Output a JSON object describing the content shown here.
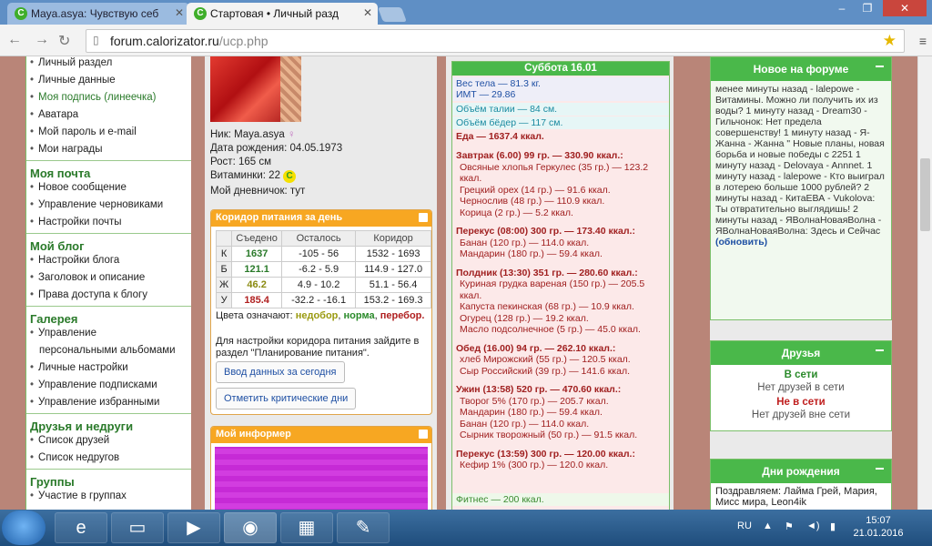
{
  "browser": {
    "tabs": [
      {
        "favicon": "C",
        "title": "Maya.asya: Чувствую себ"
      },
      {
        "favicon": "C",
        "title": "Стартовая • Личный разд"
      }
    ],
    "url_host": "forum.calorizator.ru",
    "url_path": "/ucp.php"
  },
  "sidebar": {
    "items_top": [
      "Личный раздел",
      "Личные данные",
      "Моя подпись (линеечка)",
      "Аватара",
      "Мой пароль и e-mail",
      "Мои награды"
    ],
    "sections": [
      {
        "title": "Моя почта",
        "items": [
          "Новое сообщение",
          "Управление черновиками",
          "Настройки почты"
        ]
      },
      {
        "title": "Мой блог",
        "items": [
          "Настройки блога",
          "Заголовок и описание",
          "Права доступа к блогу"
        ]
      },
      {
        "title": "Галерея",
        "items": [
          "Управление",
          "персональными альбомами",
          "Личные настройки",
          "Управление подписками",
          "Управление избранными"
        ]
      },
      {
        "title": "Друзья и недруги",
        "items": [
          "Список друзей",
          "Список недругов"
        ]
      },
      {
        "title": "Группы",
        "items": [
          "Участие в группах"
        ]
      }
    ]
  },
  "profile": {
    "nick_label": "Ник:",
    "nick": "Maya.asya",
    "birth_label": "Дата рождения:",
    "birth": "04.05.1973",
    "height_label": "Рост:",
    "height": "165 см",
    "vitamins_label": "Витаминки:",
    "vitamins": "22",
    "diary_label": "Мой дневничок:",
    "diary": "тут"
  },
  "corridor": {
    "title": "Коридор питания за день",
    "headers": [
      "Съедено",
      "Осталось",
      "Коридор"
    ],
    "rows": [
      {
        "l": "К",
        "eaten": "1637",
        "left1": "-105",
        "left2": "56",
        "c1": "1532",
        "c2": "1693"
      },
      {
        "l": "Б",
        "eaten": "121.1",
        "left1": "-6.2",
        "left2": "5.9",
        "c1": "114.9",
        "c2": "127.0"
      },
      {
        "l": "Ж",
        "eaten": "46.2",
        "left1": "4.9",
        "left2": "10.2",
        "c1": "51.1",
        "c2": "56.4"
      },
      {
        "l": "У",
        "eaten": "185.4",
        "left1": "-32.2",
        "left2": "-16.1",
        "c1": "153.2",
        "c2": "169.3"
      }
    ],
    "colors_text": "Цвета означают:",
    "c_under": "недобор",
    "c_norm": "норма",
    "c_over": "перебор.",
    "note": "Для настройки коридора питания зайдите в раздел \"Планирование питания\".",
    "btn_today": "Ввод данных за сегодня",
    "btn_crit": "Отметить критические дни"
  },
  "informer": {
    "title": "Мой информер"
  },
  "diary": {
    "date": "Суббота 16.01",
    "weight": "Вес тела — 81.3 кг.",
    "bmi": "ИМТ — 29.86",
    "waist": "Объём талии — 84 см.",
    "hips": "Объём бёдер — 117 см.",
    "food_total": "Еда — 1637.4 ккал.",
    "lines": [
      {
        "t": "Завтрак (6.00) 99 гр. — 330.90 ккал.:",
        "k": "meal"
      },
      {
        "t": "Овсяные хлопья Геркулес (35 гр.) — 123.2",
        "k": "sub"
      },
      {
        "t": "ккал.",
        "k": "sub"
      },
      {
        "t": "Грецкий орех (14 гр.) — 91.6 ккал.",
        "k": "sub"
      },
      {
        "t": "Чернослив (48 гр.) — 110.9 ккал.",
        "k": "sub"
      },
      {
        "t": "Корица (2 гр.) — 5.2 ккал.",
        "k": "sub"
      },
      {
        "t": "",
        "k": "gap"
      },
      {
        "t": "Перекус (08:00) 300 гр. — 173.40 ккал.:",
        "k": "meal"
      },
      {
        "t": "Банан (120 гр.) — 114.0 ккал.",
        "k": "sub"
      },
      {
        "t": "Мандарин (180 гр.) — 59.4 ккал.",
        "k": "sub"
      },
      {
        "t": "",
        "k": "gap"
      },
      {
        "t": "Полдник (13:30) 351 гр. — 280.60 ккал.:",
        "k": "meal"
      },
      {
        "t": "Куриная грудка вареная (150 гр.) — 205.5",
        "k": "sub"
      },
      {
        "t": "ккал.",
        "k": "sub"
      },
      {
        "t": "Капуста пекинская (68 гр.) — 10.9 ккал.",
        "k": "sub"
      },
      {
        "t": "Огурец (128 гр.) — 19.2 ккал.",
        "k": "sub"
      },
      {
        "t": "Масло подсолнечное (5 гр.) — 45.0 ккал.",
        "k": "sub"
      },
      {
        "t": "",
        "k": "gap"
      },
      {
        "t": "Обед (16.00) 94 гр. — 262.10 ккал.:",
        "k": "meal"
      },
      {
        "t": "хлеб Мирожский (55 гр.) — 120.5 ккал.",
        "k": "sub"
      },
      {
        "t": "Сыр Российский (39 гр.) — 141.6 ккал.",
        "k": "sub"
      },
      {
        "t": "",
        "k": "gap"
      },
      {
        "t": "Ужин (13:58) 520 гр. — 470.60 ккал.:",
        "k": "meal"
      },
      {
        "t": "Творог 5% (170 гр.) — 205.7 ккал.",
        "k": "sub"
      },
      {
        "t": "Мандарин (180 гр.) — 59.4 ккал.",
        "k": "sub"
      },
      {
        "t": "Банан (120 гр.) — 114.0 ккал.",
        "k": "sub"
      },
      {
        "t": "Сырник творожный (50 гр.) — 91.5 ккал.",
        "k": "sub"
      },
      {
        "t": "",
        "k": "gap"
      },
      {
        "t": "Перекус (13:59) 300 гр. — 120.00 ккал.:",
        "k": "meal"
      },
      {
        "t": "Кефир 1% (300 гр.) — 120.0 ккал.",
        "k": "sub"
      }
    ],
    "fitness": "Фитнес — 200 ккал."
  },
  "forum_new": {
    "title": "Новое на форуме",
    "text": "менее минуты назад - lalepowe - Витамины. Можно ли получить их из воды? 1 минуту назад - Dream30 - Гильчонок: Нет предела совершенству! 1 минуту назад - Я-Жанна - Жанна \" Новые планы, новая борьба и новые победы с 2251 1 минуту назад - Delovaya - Annnet. 1 минуту назад - lalepowe - Кто выиграл в лотерею больше 1000 рублей? 2 минуты назад - КитаЕВА - Vukolova: Ты отвратительно выглядишь! 2 минуты назад - ЯВолнаНоваяВолна - ЯВолнаНоваяВолна: Здесь и Сейчас",
    "refresh": "(обновить)"
  },
  "friends": {
    "title": "Друзья",
    "online": "В сети",
    "online_none": "Нет друзей в сети",
    "offline": "Не в сети",
    "offline_none": "Нет друзей вне сети"
  },
  "birthdays": {
    "title": "Дни рождения",
    "text": "Поздравляем: Лайма Грей, Мария, Мисс мира, Leon4ik"
  },
  "tray": {
    "lang": "RU",
    "time": "15:07",
    "date": "21.01.2016"
  }
}
